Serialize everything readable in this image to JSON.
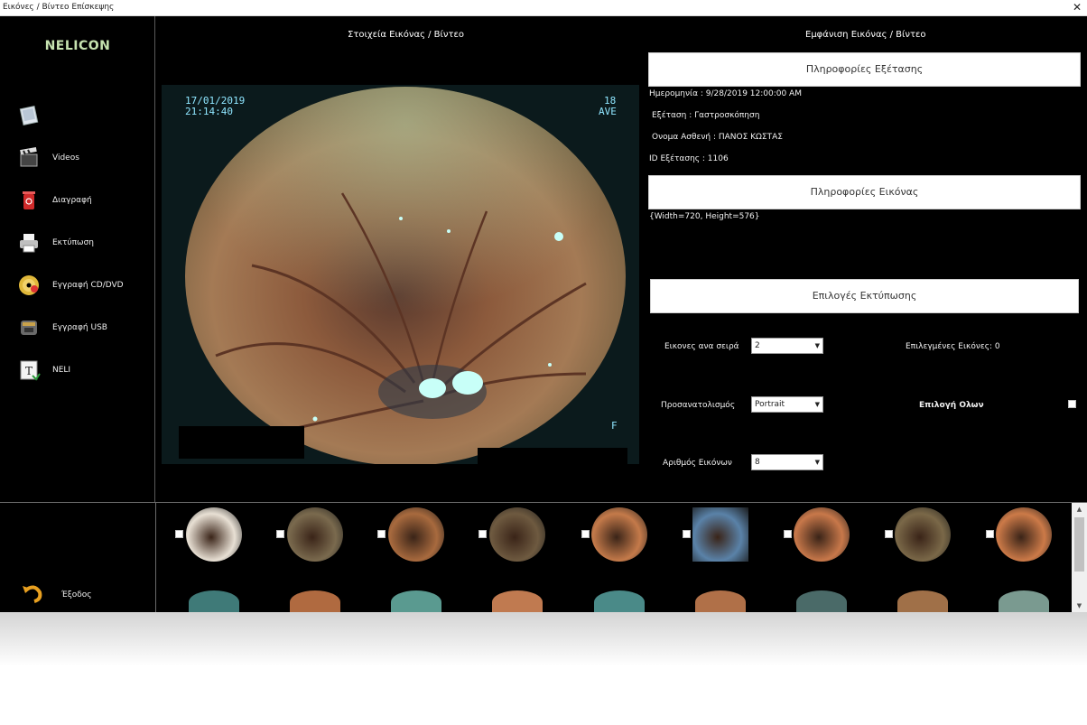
{
  "window_title": "Εικόνες / Βίντεο Επίσκεψης",
  "close_glyph": "✕",
  "brand": "NELICON",
  "sidebar": {
    "items": [
      {
        "label": "",
        "icon": "gallery-icon"
      },
      {
        "label": "Videos",
        "icon": "film-clapper-icon"
      },
      {
        "label": "Διαγραφή",
        "icon": "trash-icon"
      },
      {
        "label": "Εκτύπωση",
        "icon": "printer-icon"
      },
      {
        "label": "Εγγραφή CD/DVD",
        "icon": "disc-icon"
      },
      {
        "label": "Εγγραφή USB",
        "icon": "usb-drive-icon"
      },
      {
        "label": "NELI",
        "icon": "text-document-icon"
      }
    ],
    "exit_label": "Έξοδος",
    "exit_icon": "undo-arrow-icon"
  },
  "headings": {
    "image_details": "Στοιχεία Εικόνας / Βίντεο",
    "display": "Εμφάνιση Εικόνας / Βίντεο"
  },
  "viewer": {
    "osd_date": "17/01/2019",
    "osd_time": "21:14:40",
    "osd_num": "18",
    "osd_mode": "AVE",
    "osd_flag": "F"
  },
  "exam_info": {
    "button": "Πληροφορίες Εξέτασης",
    "date": "Ημερομηνία : 9/28/2019 12:00:00 AM",
    "exam": "Εξέταση : Γαστροσκόπηση",
    "patient": "Ονομα Ασθενή : ΠΑΝΟΣ ΚΩΣΤΑΣ",
    "id": "ID Εξέτασης : 1106"
  },
  "image_info": {
    "button": "Πληροφορίες Εικόνας",
    "size": "{Width=720, Height=576}"
  },
  "print_options": {
    "button": "Επιλογές Εκτύπωσης",
    "per_row_label": "Εικονες ανα σειρά",
    "per_row_value": "2",
    "orientation_label": "Προσανατολισμός",
    "orientation_value": "Portrait",
    "count_label": "Αριθμός Εικόνων",
    "count_value": "8",
    "selected_label": "Επιλεγμένες Εικόνες: 0",
    "select_all_label": "Επιλογή Ολων",
    "select_all_checked": false
  },
  "thumbnails": [
    {
      "tone": "#e8e0d4",
      "checked": false
    },
    {
      "tone": "#7a6a4e",
      "checked": false
    },
    {
      "tone": "#a86a3e",
      "checked": false
    },
    {
      "tone": "#6e5a40",
      "checked": false
    },
    {
      "tone": "#c47a4a",
      "checked": false
    },
    {
      "tone": "#5a82a8",
      "checked": false,
      "selected": true
    },
    {
      "tone": "#c8784a",
      "checked": false
    },
    {
      "tone": "#7a6848",
      "checked": false
    },
    {
      "tone": "#cc7a48",
      "checked": false
    }
  ],
  "colors": {
    "background": "#000000",
    "brand": "#c6e2b0",
    "selected_thumb": "#5a82a8"
  }
}
